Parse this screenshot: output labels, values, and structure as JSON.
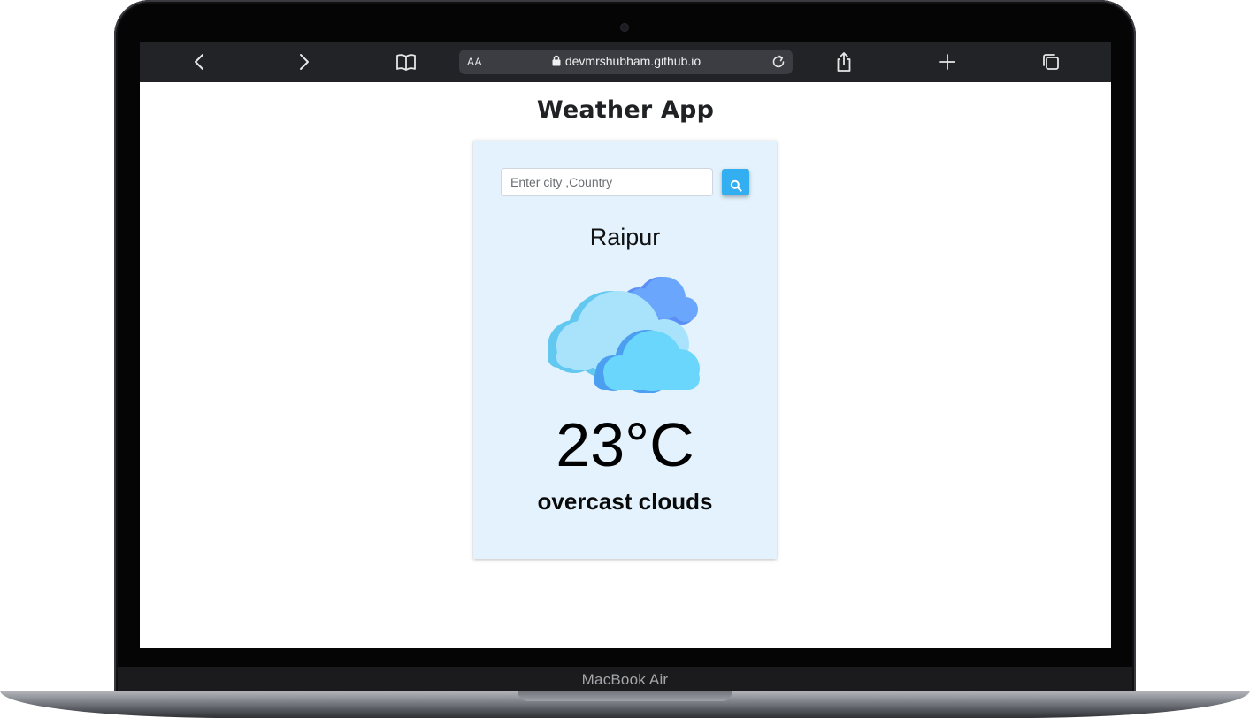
{
  "browser": {
    "text_size_label": "AA",
    "url": "devmrshubham.github.io"
  },
  "page": {
    "title": "Weather App"
  },
  "search": {
    "placeholder": "Enter city ,Country",
    "value": ""
  },
  "weather": {
    "city": "Raipur",
    "temperature": "23°C",
    "description": "overcast clouds",
    "icon": "clouds-icon"
  },
  "device": {
    "label": "MacBook Air"
  },
  "colors": {
    "card_background": "#e3f2fc",
    "search_button": "#33aef0",
    "toolbar": "#212326"
  }
}
